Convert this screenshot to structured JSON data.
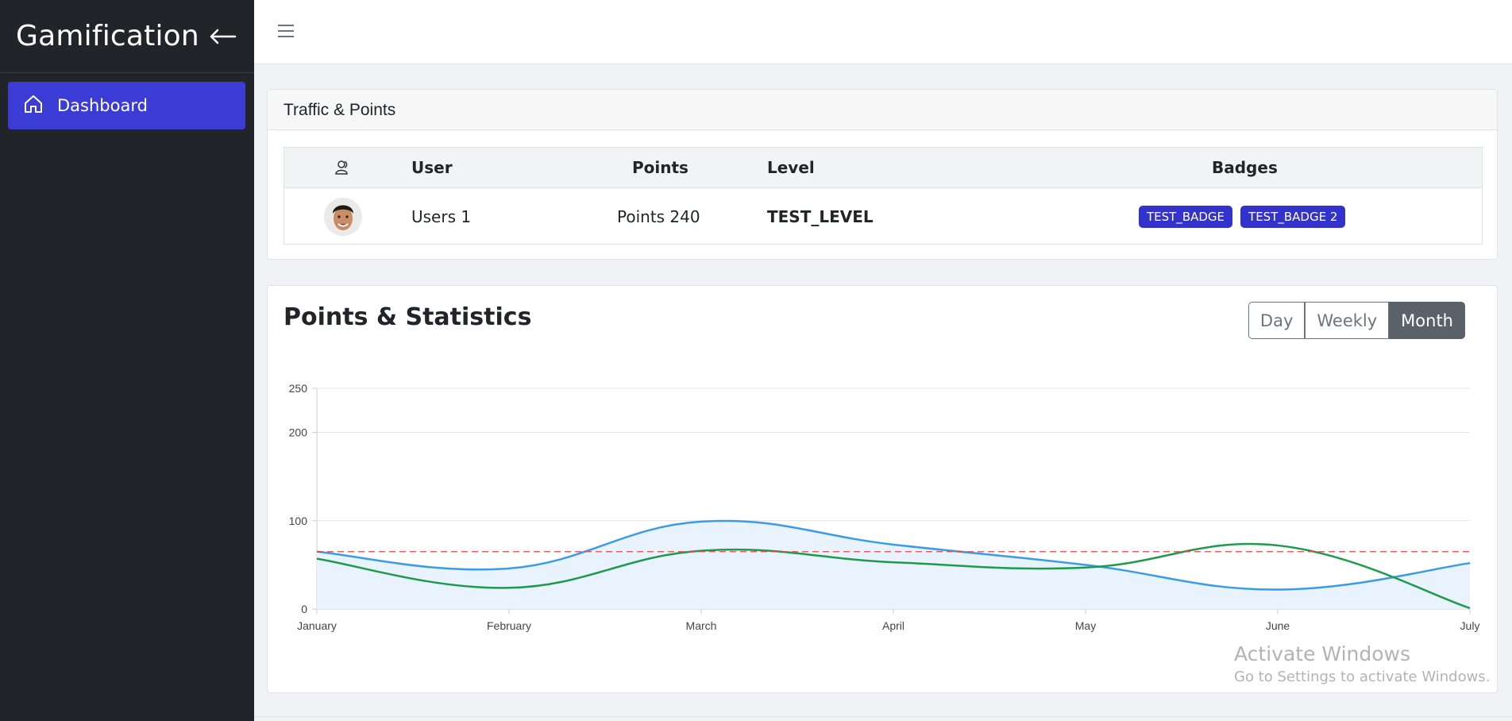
{
  "app": {
    "title": "Gamification"
  },
  "sidebar": {
    "items": [
      {
        "label": "Dashboard",
        "icon": "home-icon",
        "active": true
      }
    ]
  },
  "traffic_card": {
    "title": "Traffic & Points",
    "columns": {
      "avatar_icon": "users-icon",
      "user": "User",
      "points": "Points",
      "level": "Level",
      "badges": "Badges"
    },
    "rows": [
      {
        "user": "Users 1",
        "points": "Points 240",
        "level": "TEST_LEVEL",
        "badges": [
          "TEST_BADGE",
          "TEST_BADGE 2"
        ]
      }
    ]
  },
  "stats_card": {
    "title": "Points & Statistics",
    "ranges": [
      "Day",
      "Weekly",
      "Month"
    ],
    "active_range": "Month"
  },
  "chart_data": {
    "type": "line",
    "categories": [
      "January",
      "February",
      "March",
      "April",
      "May",
      "June",
      "July"
    ],
    "y_ticks": [
      0,
      100,
      200,
      250
    ],
    "ylim": [
      0,
      250
    ],
    "grid": true,
    "series": [
      {
        "values": [
          65,
          46,
          99,
          73,
          50,
          22,
          52
        ],
        "color": "#3b9be8",
        "fill": "#e8f3fd"
      },
      {
        "values": [
          57,
          24,
          66,
          53,
          47,
          72,
          1
        ],
        "color": "#1f9a4c"
      }
    ],
    "reference_line": {
      "value": 65,
      "color": "#e8474b",
      "dashed": true
    }
  },
  "watermark": {
    "line1": "Activate Windows",
    "line2": "Go to Settings to activate Windows."
  }
}
